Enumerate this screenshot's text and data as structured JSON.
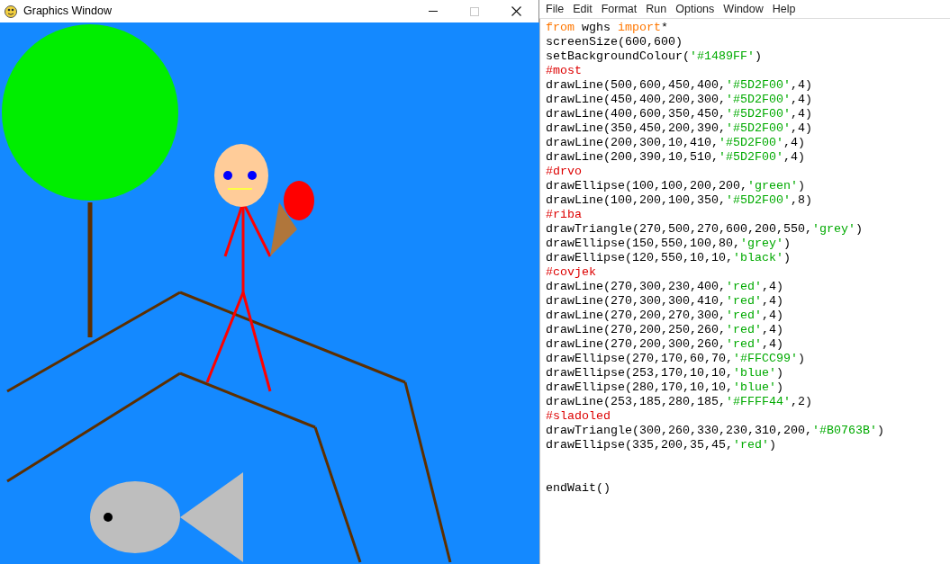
{
  "graphics_window": {
    "title": "Graphics Window"
  },
  "editor": {
    "menu": [
      "File",
      "Edit",
      "Format",
      "Run",
      "Options",
      "Window",
      "Help"
    ],
    "lines": [
      {
        "kind": "code",
        "tokens": [
          {
            "kind": "keyword",
            "text": "from"
          },
          {
            "kind": "plain",
            "text": " wghs "
          },
          {
            "kind": "keyword",
            "text": "import"
          },
          {
            "kind": "plain",
            "text": "*"
          }
        ]
      },
      {
        "kind": "code",
        "tokens": [
          {
            "kind": "plain",
            "text": "screenSize(600,600)"
          }
        ]
      },
      {
        "kind": "code",
        "tokens": [
          {
            "kind": "plain",
            "text": "setBackgroundColour("
          },
          {
            "kind": "string",
            "text": "'#1489FF'"
          },
          {
            "kind": "plain",
            "text": ")"
          }
        ]
      },
      {
        "kind": "code",
        "tokens": [
          {
            "kind": "comment",
            "text": "#most"
          }
        ]
      },
      {
        "kind": "code",
        "tokens": [
          {
            "kind": "plain",
            "text": "drawLine(500,600,450,400,"
          },
          {
            "kind": "string",
            "text": "'#5D2F00'"
          },
          {
            "kind": "plain",
            "text": ",4)"
          }
        ]
      },
      {
        "kind": "code",
        "tokens": [
          {
            "kind": "plain",
            "text": "drawLine(450,400,200,300,"
          },
          {
            "kind": "string",
            "text": "'#5D2F00'"
          },
          {
            "kind": "plain",
            "text": ",4)"
          }
        ]
      },
      {
        "kind": "code",
        "tokens": [
          {
            "kind": "plain",
            "text": "drawLine(400,600,350,450,"
          },
          {
            "kind": "string",
            "text": "'#5D2F00'"
          },
          {
            "kind": "plain",
            "text": ",4)"
          }
        ]
      },
      {
        "kind": "code",
        "tokens": [
          {
            "kind": "plain",
            "text": "drawLine(350,450,200,390,"
          },
          {
            "kind": "string",
            "text": "'#5D2F00'"
          },
          {
            "kind": "plain",
            "text": ",4)"
          }
        ]
      },
      {
        "kind": "code",
        "tokens": [
          {
            "kind": "plain",
            "text": "drawLine(200,300,10,410,"
          },
          {
            "kind": "string",
            "text": "'#5D2F00'"
          },
          {
            "kind": "plain",
            "text": ",4)"
          }
        ]
      },
      {
        "kind": "code",
        "tokens": [
          {
            "kind": "plain",
            "text": "drawLine(200,390,10,510,"
          },
          {
            "kind": "string",
            "text": "'#5D2F00'"
          },
          {
            "kind": "plain",
            "text": ",4)"
          }
        ]
      },
      {
        "kind": "code",
        "tokens": [
          {
            "kind": "comment",
            "text": "#drvo"
          }
        ]
      },
      {
        "kind": "code",
        "tokens": [
          {
            "kind": "plain",
            "text": "drawEllipse(100,100,200,200,"
          },
          {
            "kind": "string",
            "text": "'green'"
          },
          {
            "kind": "plain",
            "text": ")"
          }
        ]
      },
      {
        "kind": "code",
        "tokens": [
          {
            "kind": "plain",
            "text": "drawLine(100,200,100,350,"
          },
          {
            "kind": "string",
            "text": "'#5D2F00'"
          },
          {
            "kind": "plain",
            "text": ",8)"
          }
        ]
      },
      {
        "kind": "code",
        "tokens": [
          {
            "kind": "comment",
            "text": "#riba"
          }
        ]
      },
      {
        "kind": "code",
        "tokens": [
          {
            "kind": "plain",
            "text": "drawTriangle(270,500,270,600,200,550,"
          },
          {
            "kind": "string",
            "text": "'grey'"
          },
          {
            "kind": "plain",
            "text": ")"
          }
        ]
      },
      {
        "kind": "code",
        "tokens": [
          {
            "kind": "plain",
            "text": "drawEllipse(150,550,100,80,"
          },
          {
            "kind": "string",
            "text": "'grey'"
          },
          {
            "kind": "plain",
            "text": ")"
          }
        ]
      },
      {
        "kind": "code",
        "tokens": [
          {
            "kind": "plain",
            "text": "drawEllipse(120,550,10,10,"
          },
          {
            "kind": "string",
            "text": "'black'"
          },
          {
            "kind": "plain",
            "text": ")"
          }
        ]
      },
      {
        "kind": "code",
        "tokens": [
          {
            "kind": "comment",
            "text": "#covjek"
          }
        ]
      },
      {
        "kind": "code",
        "tokens": [
          {
            "kind": "plain",
            "text": "drawLine(270,300,230,400,"
          },
          {
            "kind": "string",
            "text": "'red'"
          },
          {
            "kind": "plain",
            "text": ",4)"
          }
        ]
      },
      {
        "kind": "code",
        "tokens": [
          {
            "kind": "plain",
            "text": "drawLine(270,300,300,410,"
          },
          {
            "kind": "string",
            "text": "'red'"
          },
          {
            "kind": "plain",
            "text": ",4)"
          }
        ]
      },
      {
        "kind": "code",
        "tokens": [
          {
            "kind": "plain",
            "text": "drawLine(270,200,270,300,"
          },
          {
            "kind": "string",
            "text": "'red'"
          },
          {
            "kind": "plain",
            "text": ",4)"
          }
        ]
      },
      {
        "kind": "code",
        "tokens": [
          {
            "kind": "plain",
            "text": "drawLine(270,200,250,260,"
          },
          {
            "kind": "string",
            "text": "'red'"
          },
          {
            "kind": "plain",
            "text": ",4)"
          }
        ]
      },
      {
        "kind": "code",
        "tokens": [
          {
            "kind": "plain",
            "text": "drawLine(270,200,300,260,"
          },
          {
            "kind": "string",
            "text": "'red'"
          },
          {
            "kind": "plain",
            "text": ",4)"
          }
        ]
      },
      {
        "kind": "code",
        "tokens": [
          {
            "kind": "plain",
            "text": "drawEllipse(270,170,60,70,"
          },
          {
            "kind": "string",
            "text": "'#FFCC99'"
          },
          {
            "kind": "plain",
            "text": ")"
          }
        ]
      },
      {
        "kind": "code",
        "tokens": [
          {
            "kind": "plain",
            "text": "drawEllipse(253,170,10,10,"
          },
          {
            "kind": "string",
            "text": "'blue'"
          },
          {
            "kind": "plain",
            "text": ")"
          }
        ]
      },
      {
        "kind": "code",
        "tokens": [
          {
            "kind": "plain",
            "text": "drawEllipse(280,170,10,10,"
          },
          {
            "kind": "string",
            "text": "'blue'"
          },
          {
            "kind": "plain",
            "text": ")"
          }
        ]
      },
      {
        "kind": "code",
        "tokens": [
          {
            "kind": "plain",
            "text": "drawLine(253,185,280,185,"
          },
          {
            "kind": "string",
            "text": "'#FFFF44'"
          },
          {
            "kind": "plain",
            "text": ",2)"
          }
        ]
      },
      {
        "kind": "code",
        "tokens": [
          {
            "kind": "comment",
            "text": "#sladoled"
          }
        ]
      },
      {
        "kind": "code",
        "tokens": [
          {
            "kind": "plain",
            "text": "drawTriangle(300,260,330,230,310,200,"
          },
          {
            "kind": "string",
            "text": "'#B0763B'"
          },
          {
            "kind": "plain",
            "text": ")"
          }
        ]
      },
      {
        "kind": "code",
        "tokens": [
          {
            "kind": "plain",
            "text": "drawEllipse(335,200,35,45,"
          },
          {
            "kind": "string",
            "text": "'red'"
          },
          {
            "kind": "plain",
            "text": ")"
          }
        ]
      },
      {
        "kind": "blank"
      },
      {
        "kind": "blank"
      },
      {
        "kind": "code",
        "tokens": [
          {
            "kind": "plain",
            "text": "endWait()"
          }
        ]
      }
    ]
  }
}
